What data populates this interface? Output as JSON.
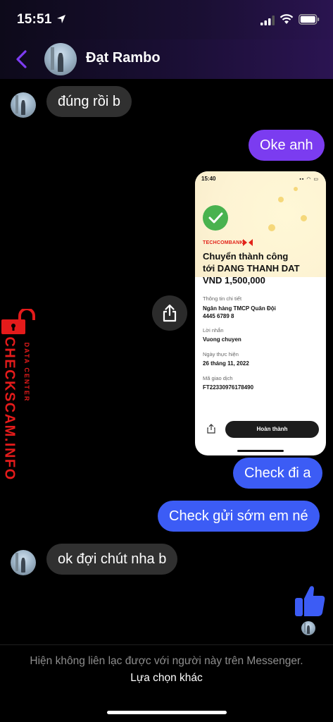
{
  "status_bar": {
    "time": "15:51"
  },
  "header": {
    "contact_name": "Đạt Rambo"
  },
  "messages": {
    "m1": "đúng rồi b",
    "m2": "Oke anh",
    "m3": "Check đi a",
    "m4": "Check gửi sớm em né",
    "m5": "ok đợi chút nha b"
  },
  "receipt": {
    "time": "15:40",
    "bank": "TECHCOMBANK",
    "title_line1": "Chuyển thành công",
    "title_line2": "tới DANG THANH DAT",
    "title_line3": "VND 1,500,000",
    "details_label": "Thông tin chi tiết",
    "bank_name": "Ngân hàng TMCP Quân Đội",
    "account": "4445 6789 8",
    "message_label": "Lời nhắn",
    "message_value": "Vuong chuyen",
    "date_label": "Ngày thực hiện",
    "date_value": "26 tháng 11, 2022",
    "txn_label": "Mã giao dịch",
    "txn_value": "FT22330976178490",
    "done_button": "Hoàn thành"
  },
  "watermark": {
    "main": "CHECKSCAM.INFO",
    "sub": "DATA CENTER"
  },
  "footer": {
    "notice": "Hiện không liên lạc được với người này trên Messenger.",
    "link": "Lựa chọn khác"
  },
  "colors": {
    "purple_bubble": "#7b3cf0",
    "blue_bubble": "#3c5cf5",
    "incoming_bubble": "#303030",
    "accent": "#7d3cf2",
    "like": "#3c5cf5"
  }
}
